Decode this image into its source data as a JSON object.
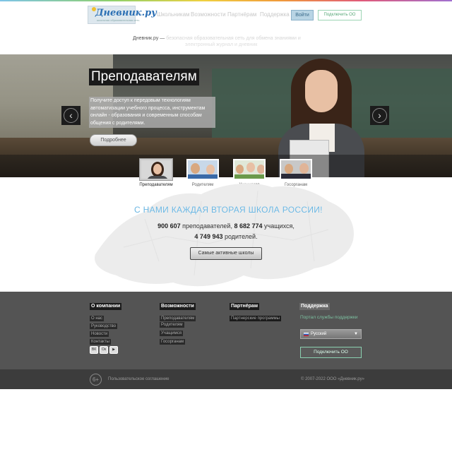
{
  "header": {
    "logo_text": "Дневник.ру",
    "logo_subtitle": "школьная образовательная сеть",
    "nav": [
      "Школьникам",
      "Возможности",
      "Партнёрам",
      "Поддержка"
    ],
    "login_label": "Войти",
    "connect_label": "Подключить ОО",
    "tagline_brand": "Дневник.ру —",
    "tagline_text": " безопасная образовательная сеть для обмена знаниями и",
    "tagline_line2": "электронный журнал и дневник"
  },
  "hero": {
    "title": "Преподавателям",
    "description": "Получите доступ к передовым технологиям автоматизации учебного процесса, инструментам онлайн - образования и современным способам общения с родителями.",
    "more_label": "Подробнее",
    "prev_icon": "chevron-left-icon",
    "next_icon": "chevron-right-icon",
    "tabs": [
      {
        "label": "Преподавателям",
        "active": true
      },
      {
        "label": "Родителям",
        "active": false
      },
      {
        "label": "Учащимся",
        "active": false
      },
      {
        "label": "Госорганам",
        "active": false
      }
    ]
  },
  "stats": {
    "headline": "С НАМИ КАЖДАЯ ВТОРАЯ ШКОЛА РОССИИ!",
    "teachers_count": "900 607",
    "teachers_label": " преподавателей, ",
    "students_count": "8 682 774",
    "students_label": " учащихся,",
    "parents_count": "4 749 943",
    "parents_label": " родителей.",
    "active_schools_label": "Самые активные школы"
  },
  "footer": {
    "columns": [
      {
        "title": "О компании",
        "links": [
          "О нас",
          "Руководство",
          "Новости",
          "Контакты"
        ]
      },
      {
        "title": "Возможности",
        "links": [
          "Преподавателям",
          "Родителям",
          "Учащимся",
          "Госорганам"
        ]
      },
      {
        "title": "Партнёрам",
        "links": [
          "Партнерские программы"
        ]
      },
      {
        "title": "Поддержка",
        "links": []
      }
    ],
    "support_portal": "Портал службы поддержки",
    "language": "Русский",
    "connect_label": "Подключить ОО",
    "social": [
      "ВК",
      "Ок",
      "▶"
    ],
    "age_rating": "6+",
    "agreement": "Пользовательское соглашение",
    "copyright": "© 2007-2022 ООО «Дневник.ру»"
  },
  "colors": {
    "accent_blue": "#6ab6e2",
    "accent_green": "#7cc0a0",
    "footer_bg": "#545454"
  }
}
